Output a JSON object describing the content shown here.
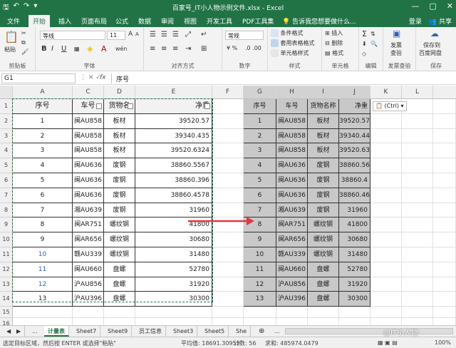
{
  "window": {
    "title": "百家号_IT小人物示例文件.xlsx - Excel",
    "qa_save": "🖫",
    "qa_undo": "↶",
    "qa_redo": "↷",
    "qa_more": "▾",
    "minimize": "—",
    "restore": "▢",
    "close": "✕"
  },
  "tabs": {
    "items": [
      "文件",
      "开始",
      "插入",
      "页面布局",
      "公式",
      "数据",
      "审阅",
      "视图",
      "开发工具",
      "PDF工具集"
    ],
    "active": "开始",
    "tellme": "告诉我您想要做什么...",
    "login": "登录",
    "share": "共享"
  },
  "ribbon": {
    "clipboard": {
      "paste": "粘贴",
      "label": "剪贴板"
    },
    "font": {
      "name": "等线",
      "size": "11",
      "grow": "A",
      "shrink": "A",
      "bold": "B",
      "italic": "I",
      "underline": "U",
      "bigwen": "wén",
      "label": "字体"
    },
    "align": {
      "label": "对齐方式"
    },
    "number": {
      "format": "常规",
      "label": "数字"
    },
    "styles": {
      "cond": "条件格式",
      "table": "套用表格格式",
      "cellstyle": "单元格样式",
      "label": "样式"
    },
    "cells": {
      "insert": "插入",
      "delete": "删除",
      "format": "格式",
      "label": "单元格"
    },
    "edit": {
      "sigma": "Σ",
      "label": "编辑"
    },
    "invoice": {
      "btn1": "发票",
      "btn1b": "查验",
      "label": "发票查验"
    },
    "save": {
      "btn1": "保存到",
      "btn1b": "百度网盘",
      "label": "保存"
    }
  },
  "formula_bar": {
    "name_box": "G1",
    "fx": "fx",
    "content": "序号"
  },
  "grid": {
    "columns": [
      "A",
      "C",
      "D",
      "E",
      "F",
      "G",
      "H",
      "I",
      "J",
      "K",
      "L"
    ],
    "rows": [
      "1",
      "2",
      "3",
      "4",
      "5",
      "6",
      "7",
      "8",
      "9",
      "10",
      "11",
      "12",
      "13",
      "14",
      "15",
      "16"
    ],
    "headers": [
      "序号",
      "车号",
      "货物名称",
      "净重"
    ],
    "source_headers": [
      "序号",
      "车号",
      "货物名",
      "净重"
    ],
    "source_rows": [
      [
        "1",
        "闽AU858",
        "板材",
        "39520.57"
      ],
      [
        "2",
        "闽AU858",
        "板材",
        "39340.435"
      ],
      [
        "3",
        "闽AU858",
        "板材",
        "39520.6324"
      ],
      [
        "4",
        "闽AU636",
        "废钢",
        "38860.5567"
      ],
      [
        "5",
        "闽AU636",
        "废钢",
        "38860.396"
      ],
      [
        "6",
        "闽AU636",
        "废钢",
        "38860.4578"
      ],
      [
        "7",
        "湘AU639",
        "废钢",
        "31960"
      ],
      [
        "8",
        "闽AR751",
        "螺纹钢",
        "41800"
      ],
      [
        "9",
        "闽AR656",
        "螺纹钢",
        "30680"
      ],
      [
        "10",
        "赣AU339",
        "螺纹钢",
        "31480"
      ],
      [
        "11",
        "闽AU660",
        "盘螺",
        "52780"
      ],
      [
        "12",
        "沪AU856",
        "盘螺",
        "31920"
      ],
      [
        "13",
        "沪AU396",
        "盘螺",
        "30300"
      ]
    ],
    "pasted_rows": [
      [
        "1",
        "闽AU858",
        "板材",
        "39520.57"
      ],
      [
        "2",
        "闽AU858",
        "板材",
        "39340.44"
      ],
      [
        "3",
        "闽AU858",
        "板材",
        "39520.63"
      ],
      [
        "4",
        "闽AU636",
        "废钢",
        "38860.56"
      ],
      [
        "5",
        "闽AU636",
        "废钢",
        "38860.4"
      ],
      [
        "6",
        "闽AU636",
        "废钢",
        "38860.46"
      ],
      [
        "7",
        "湘AU639",
        "废钢",
        "31960"
      ],
      [
        "8",
        "闽AR751",
        "螺纹钢",
        "41800"
      ],
      [
        "9",
        "闽AR656",
        "螺纹钢",
        "30680"
      ],
      [
        "10",
        "赣AU339",
        "螺纹钢",
        "31480"
      ],
      [
        "11",
        "闽AU660",
        "盘螺",
        "52780"
      ],
      [
        "12",
        "沪AU856",
        "盘螺",
        "31920"
      ],
      [
        "13",
        "沪AU396",
        "盘螺",
        "30300"
      ]
    ],
    "paste_badge": "(Ctrl)"
  },
  "sheets": {
    "items": [
      "计量表",
      "Sheet7",
      "Sheet9",
      "员工信息",
      "Sheet3",
      "Sheet5",
      "She"
    ],
    "active": "计量表",
    "nav_left": "◀",
    "nav_right": "▶",
    "more": "...",
    "add": "⊕"
  },
  "status": {
    "message": "选定目标区域，然后按 ENTER 或选择\"粘贴\"",
    "average": "平均值: 18691.30953",
    "count": "计数: 56",
    "sum": "求和: 485974.0479",
    "zoom": "100%"
  },
  "watermark": "@IT小人物",
  "colors": {
    "excel_green": "#217346",
    "arrow_red": "#e0393e",
    "paste_gray": "#c8c8c8"
  }
}
